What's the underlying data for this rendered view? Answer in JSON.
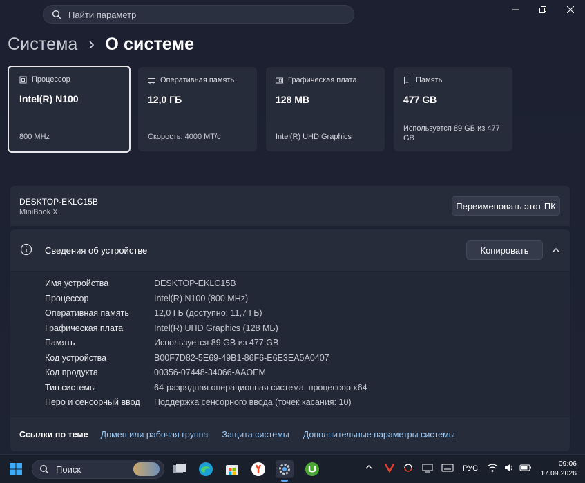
{
  "search": {
    "placeholder": "Найти параметр"
  },
  "breadcrumb": {
    "parent": "Система",
    "current": "О системе"
  },
  "cards": [
    {
      "label": "Процессор",
      "value": "Intel(R) N100",
      "sub": "800 MHz",
      "icon": "cpu-icon"
    },
    {
      "label": "Оперативная память",
      "value": "12,0 ГБ",
      "sub": "Скорость: 4000 МТ/с",
      "icon": "ram-icon"
    },
    {
      "label": "Графическая плата",
      "value": "128 MB",
      "sub": "Intel(R) UHD Graphics",
      "icon": "gpu-icon"
    },
    {
      "label": "Память",
      "value": "477 GB",
      "sub": "Используется 89 GB из 477 GB",
      "icon": "storage-icon"
    }
  ],
  "device": {
    "name": "DESKTOP-EKLC15B",
    "model": "MiniBook X",
    "rename_label": "Переименовать этот ПК"
  },
  "info": {
    "title": "Сведения об устройстве",
    "copy_label": "Копировать"
  },
  "specs": [
    {
      "key": "Имя устройства",
      "value": "DESKTOP-EKLC15B"
    },
    {
      "key": "Процессор",
      "value": "Intel(R) N100 (800 MHz)"
    },
    {
      "key": "Оперативная память",
      "value": "12,0 ГБ (доступно: 11,7 ГБ)"
    },
    {
      "key": "Графическая плата",
      "value": "Intel(R) UHD Graphics (128 МБ)"
    },
    {
      "key": "Память",
      "value": "Используется 89 GB из 477 GB"
    },
    {
      "key": "Код устройства",
      "value": "B00F7D82-5E69-49B1-86F6-E6E3EA5A0407"
    },
    {
      "key": "Код продукта",
      "value": "00356-07448-34066-AAOEM"
    },
    {
      "key": "Тип системы",
      "value": "64-разрядная операционная система, процессор x64"
    },
    {
      "key": "Перо и сенсорный ввод",
      "value": "Поддержка сенсорного ввода (точек касания: 10)"
    }
  ],
  "related": {
    "title": "Ссылки по теме",
    "links": [
      "Домен или рабочая группа",
      "Защита системы",
      "Дополнительные параметры системы"
    ]
  },
  "taskbar": {
    "search_label": "Поиск",
    "language": "РУС",
    "time": "09:06",
    "date": "17.09.2026",
    "apps": [
      "start-icon",
      "search-icon",
      "task-view-icon",
      "edge-icon",
      "store-icon",
      "yandex-icon",
      "settings-icon",
      "utorrent-icon"
    ]
  },
  "colors": {
    "accent_link": "#9ec9f2",
    "card_bg": "#272c3b",
    "window_bg": "#1d2230"
  }
}
